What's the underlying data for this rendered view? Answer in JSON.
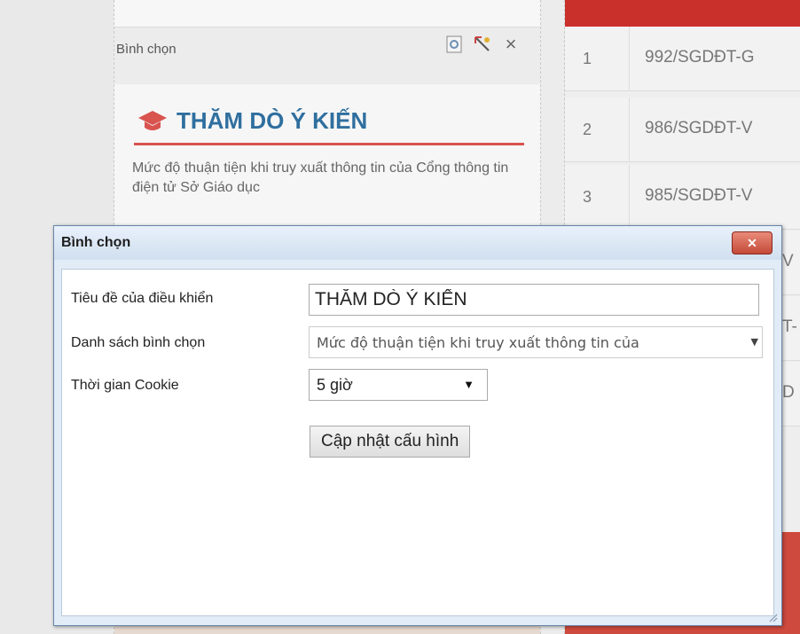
{
  "widget": {
    "name": "Bình chọn",
    "tools": {
      "edit_icon": "document-icon",
      "settings_icon": "pencil-settings-icon",
      "close_glyph": "×"
    },
    "poll_title": "THĂM DÒ Ý KIẾN",
    "poll_question": "Mức độ thuận tiện khi truy xuất thông tin của Cổng thông tin điện tử Sở Giáo dục",
    "accent_color": "#d9534f",
    "title_color": "#2f6f9f"
  },
  "table": {
    "header_color": "#c9302c",
    "rows": [
      {
        "num": "1",
        "code": "992/SGDĐT-G"
      },
      {
        "num": "2",
        "code": "986/SGDĐT-V"
      },
      {
        "num": "3",
        "code": "985/SGDĐT-V"
      }
    ],
    "partial_codes": [
      "V",
      "T-",
      "D"
    ]
  },
  "dialog": {
    "title": "Bình chọn",
    "close_glyph": "✕",
    "fields": {
      "title_label": "Tiêu đề của điều khiển",
      "title_value": "THĂM DÒ Ý KIẾN",
      "poll_label": "Danh sách bình chọn",
      "poll_value": "Mức độ thuận tiện khi truy xuất thông tin của",
      "cookie_label": "Thời gian Cookie",
      "cookie_value": "5 giờ"
    },
    "update_button": "Cập nhật cấu hình"
  }
}
